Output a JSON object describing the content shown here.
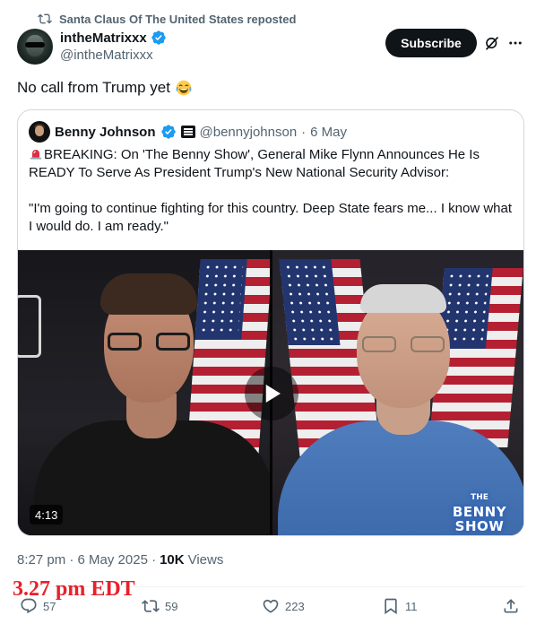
{
  "repost": {
    "label": "Santa Claus Of The United States reposted"
  },
  "author": {
    "name": "intheMatrixxx",
    "handle": "@intheMatrixxx"
  },
  "header": {
    "subscribe_label": "Subscribe"
  },
  "tweet": {
    "text": "No call from Trump yet"
  },
  "quote": {
    "name": "Benny Johnson",
    "handle": "@bennyjohnson",
    "separator": "·",
    "date": "6 May",
    "body_line1": "BREAKING: On 'The Benny Show', General Mike Flynn Announces He Is READY To Serve As President Trump's New National Security Advisor:",
    "body_line2": "\"I'm going to continue fighting for this country. Deep State fears me... I know what I would do. I am ready.\"",
    "video": {
      "duration": "4:13",
      "logo_line1": "THE",
      "logo_line2": "BENNY",
      "logo_line3": "SHOW"
    }
  },
  "meta": {
    "timestamp": "8:27 pm · 6 May 2025 ·",
    "views_count": "10K",
    "views_label": "Views"
  },
  "annotation": {
    "text": "3.27 pm EDT"
  },
  "actions": {
    "replies": "57",
    "reposts": "59",
    "likes": "223",
    "bookmarks": "11"
  },
  "colors": {
    "brand_dark": "#0f1419",
    "secondary_text": "#536471",
    "verified_blue": "#1d9bf0",
    "annotation_red": "#e8202a",
    "border": "#cfd9de"
  },
  "icons": [
    "repost-icon",
    "verified-icon",
    "grok-icon",
    "more-icon",
    "laughing-emoji-icon",
    "siren-emoji-icon",
    "play-icon",
    "reply-icon",
    "like-icon",
    "bookmark-icon",
    "share-icon"
  ]
}
